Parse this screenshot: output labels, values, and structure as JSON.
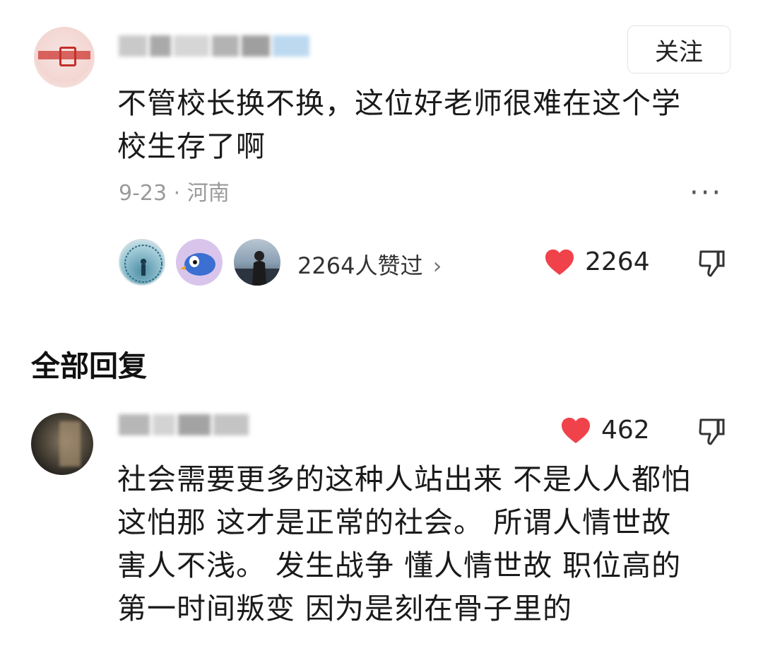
{
  "top_comment": {
    "follow_label": "关注",
    "text_line1": "不管校长换不换，这位好老师很难在这个学",
    "text_line2": "校生存了啊",
    "meta": "9-23 · 河南",
    "more_label": "···",
    "likers_text": "2264人赞过",
    "likers_chevron": "›",
    "like_count": "2264"
  },
  "section_title": "全部回复",
  "reply": {
    "like_count": "462",
    "text_lines": [
      "社会需要更多的这种人站出来 不是人人都怕",
      "这怕那 这才是正常的社会。 所谓人情世故",
      "害人不浅。 发生战争 懂人情世故 职位高的",
      "第一时间叛变 因为是刻在骨子里的"
    ]
  },
  "colors": {
    "heart": "#f0424a",
    "meta": "#9a9a9a"
  },
  "icons": [
    "heart-icon",
    "thumbs-down-icon",
    "chevron-right-icon",
    "more-icon"
  ]
}
